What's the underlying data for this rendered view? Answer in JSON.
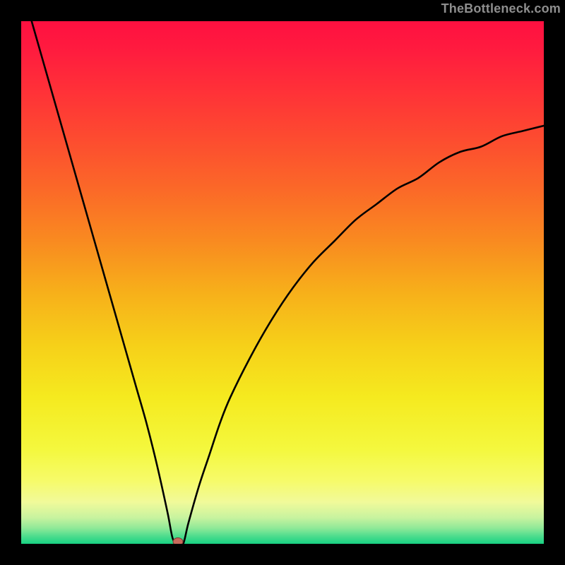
{
  "watermark": "TheBottleneck.com",
  "chart_data": {
    "type": "line",
    "title": "",
    "xlabel": "",
    "ylabel": "",
    "xlim": [
      0,
      100
    ],
    "ylim": [
      0,
      100
    ],
    "x": [
      2,
      4,
      6,
      8,
      10,
      12,
      14,
      16,
      18,
      20,
      22,
      24,
      26,
      28,
      29,
      30,
      31,
      32,
      34,
      36,
      38,
      40,
      44,
      48,
      52,
      56,
      60,
      64,
      68,
      72,
      76,
      80,
      84,
      88,
      92,
      96,
      100
    ],
    "values": [
      100,
      93,
      86,
      79,
      72,
      65,
      58,
      51,
      44,
      37,
      30,
      23,
      15,
      6,
      1,
      0,
      0,
      4,
      11,
      17,
      23,
      28,
      36,
      43,
      49,
      54,
      58,
      62,
      65,
      68,
      70,
      73,
      75,
      76,
      78,
      79,
      80
    ],
    "marker": {
      "x": 30,
      "y": 0
    },
    "background_gradient": {
      "type": "vertical",
      "stops": [
        {
          "offset": 0.0,
          "color": "#ff1040"
        },
        {
          "offset": 0.05,
          "color": "#ff1a3f"
        },
        {
          "offset": 0.13,
          "color": "#ff3038"
        },
        {
          "offset": 0.22,
          "color": "#fd4a30"
        },
        {
          "offset": 0.32,
          "color": "#fb6828"
        },
        {
          "offset": 0.42,
          "color": "#f98a20"
        },
        {
          "offset": 0.52,
          "color": "#f7b01a"
        },
        {
          "offset": 0.62,
          "color": "#f6d019"
        },
        {
          "offset": 0.72,
          "color": "#f5ea1f"
        },
        {
          "offset": 0.82,
          "color": "#f4f83e"
        },
        {
          "offset": 0.88,
          "color": "#f6fb6a"
        },
        {
          "offset": 0.92,
          "color": "#f1fa9a"
        },
        {
          "offset": 0.95,
          "color": "#c8f39f"
        },
        {
          "offset": 0.97,
          "color": "#8fe998"
        },
        {
          "offset": 0.985,
          "color": "#4fdd8e"
        },
        {
          "offset": 1.0,
          "color": "#18d183"
        }
      ]
    }
  }
}
